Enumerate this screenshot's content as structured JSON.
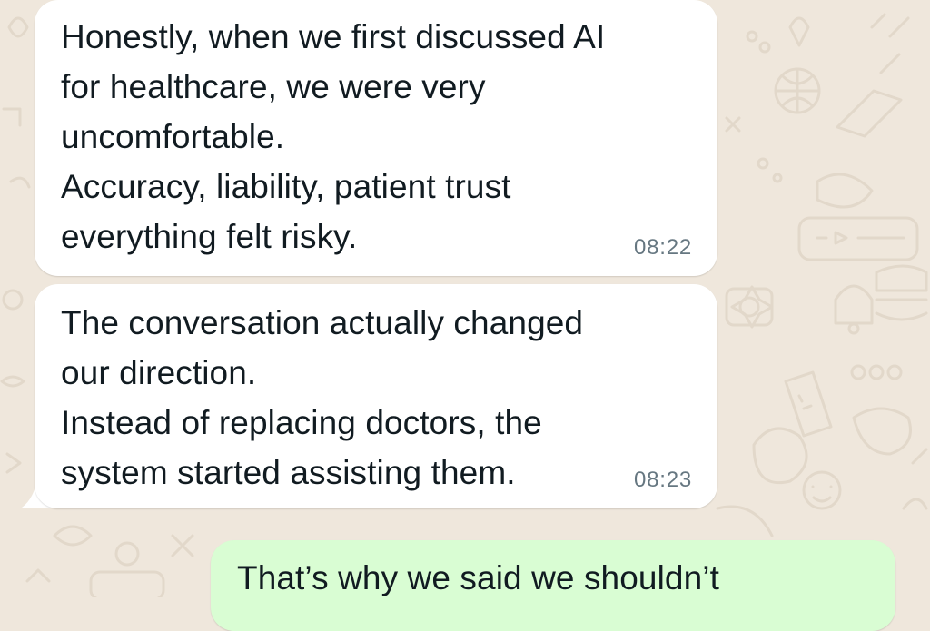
{
  "messages": [
    {
      "direction": "incoming",
      "lines": [
        "Honestly, when we first discussed AI",
        "for healthcare, we were very",
        "uncomfortable.",
        "Accuracy, liability, patient trust",
        "everything felt risky."
      ],
      "time": "08:22"
    },
    {
      "direction": "incoming",
      "lines": [
        "The conversation actually changed",
        "our direction.",
        "Instead of replacing doctors, the",
        "system started assisting them."
      ],
      "time": "08:23"
    },
    {
      "direction": "outgoing",
      "lines": [
        "That’s why we said we shouldn’t"
      ]
    }
  ],
  "colors": {
    "wallpaper": "#efe7dc",
    "incoming_bubble": "#ffffff",
    "outgoing_bubble": "#d9fdd3",
    "text": "#111b21",
    "timestamp": "#667781"
  }
}
